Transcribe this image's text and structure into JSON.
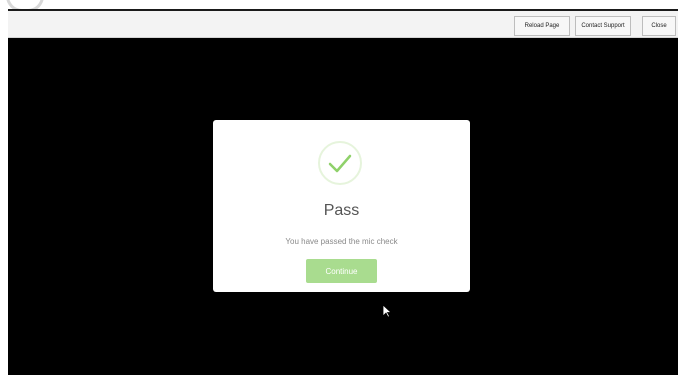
{
  "toolbar": {
    "reload_label": "Reload Page",
    "support_label": "Contact Support",
    "close_label": "Close"
  },
  "modal": {
    "icon": "checkmark-icon",
    "title": "Pass",
    "message": "You have passed the mic check",
    "continue_label": "Continue"
  },
  "colors": {
    "accent": "#a9dc8f",
    "check": "#8fd16a",
    "stage_background": "#000000",
    "toolbar_background": "#f3f3f3"
  }
}
